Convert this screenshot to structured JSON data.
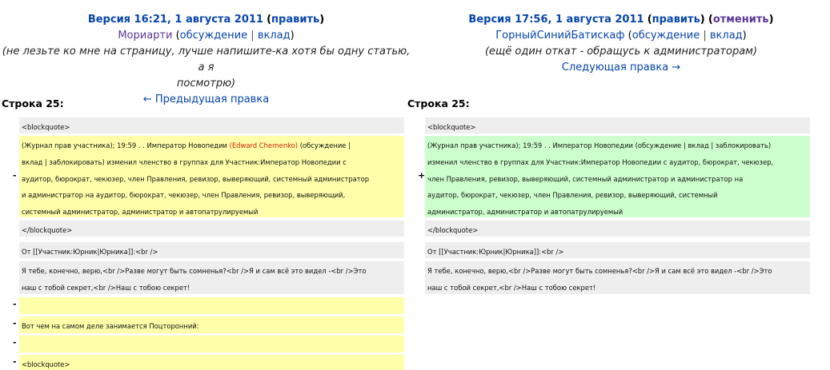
{
  "left_header": {
    "version": "Версия 16:21, 1 августа 2011",
    "edit": "править",
    "user": "Мориарти",
    "talk": "обсуждение",
    "contribs": "вклад",
    "comment_1": "(не лезьте ко мне на страницу, лучше напишите-ка хотя бы одну статью, а я",
    "comment_2": "посмотрю)",
    "prev_edit": "← Предыдущая правка"
  },
  "right_header": {
    "version": "Версия 17:56, 1 августа 2011",
    "edit": "править",
    "undo": "отменить",
    "user": "ГорныйСинийБатискаф",
    "talk": "обсуждение",
    "contribs": "вклад",
    "comment": "(ещё один откат - обращусь к администраторам)",
    "next_edit": "Следующая правка →"
  },
  "line_label_left": "Строка 25:",
  "line_label_right": "Строка 25:",
  "markers": {
    "minus": "-",
    "plus": "+"
  },
  "diff": {
    "bq_open": "<blockquote>",
    "bq_close": "</blockquote>",
    "left_changed": {
      "l1_before": "(Журнал прав участника); 19:59 . . Император Новопедии ",
      "l1_name": "(Edward Chernenko)",
      "l1_after": " (обсуждение |",
      "l2": "вклад | заблокировать) изменил членство в группах для Участник:Император Новопедии с",
      "l3": "аудитор, бюрократ, чекюзер, член Правления, ревизор, выверяющий, системный администратор",
      "l4": "и администратор на аудитор, бюрократ, чекюзер, член Правления, ревизор, выверяющий,",
      "l5": "системный администратор, администратор и автопатрулируемый"
    },
    "right_changed": {
      "l1": "(Журнал прав участника); 19:59 . . Император Новопедии (обсуждение | вклад | заблокировать)",
      "l2": "изменил членство в группах для Участник:Император Новопедии с аудитор, бюрократ, чекюзер,",
      "l3": "член Правления, ревизор, выверяющий, системный администратор и администратор на",
      "l4": "аудитор, бюрократ, чекюзер, член Правления, ревизор, выверяющий, системный",
      "l5": "администратор, администратор и автопатрулируемый"
    },
    "from_line": "От [[Участник:Юрник|Юрника]]:<br />",
    "poem_1": "Я тебе, конечно, верю,<br />Разве могут быть сомненья?<br />Я и сам всё это видел -<br />Это",
    "poem_2": "наш с тобой секрет,<br />Наш с тобою секрет!",
    "deleted_line": "Вот чем на самом деле занимается Поцторонний:",
    "bq_open_2": "<blockquote>"
  }
}
